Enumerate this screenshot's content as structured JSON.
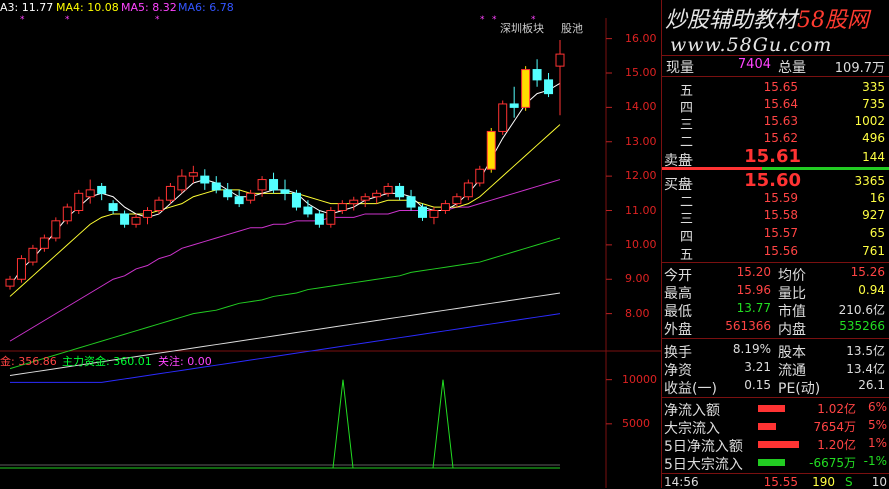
{
  "legend_top": [
    {
      "name": "MA3",
      "label": "A3: 11.77",
      "color": "#ffffff"
    },
    {
      "name": "MA4",
      "label": "MA4: 10.08",
      "color": "#ffff00"
    },
    {
      "name": "MA5",
      "label": "MA5: 8.32",
      "color": "#ff44ff"
    },
    {
      "name": "MA6",
      "label": "MA6: 6.78",
      "color": "#3355ff"
    }
  ],
  "legend_bottom": [
    {
      "name": "fund",
      "label": "金: 356.86",
      "color": "#ff4444"
    },
    {
      "name": "main-fund",
      "label": "主力资金: 360.01",
      "color": "#00ff33"
    },
    {
      "name": "attention",
      "label": "关注: 0.00",
      "color": "#ff44ff"
    }
  ],
  "chart_annotations": {
    "tag1": "深圳板块",
    "tag2": "股池"
  },
  "watermark": {
    "line1_a": "炒股辅助教材",
    "line1_b": "58股网",
    "line2": "www.58Gu.com"
  },
  "price_axis": [
    "16.00",
    "15.00",
    "14.00",
    "13.00",
    "12.00",
    "11.00",
    "10.00",
    "9.00",
    "8.00"
  ],
  "vol_axis": [
    "10000",
    "5000"
  ],
  "quote": {
    "xianliang_label": "现量",
    "xianliang": "7404",
    "zongliang_label": "总量",
    "zongliang": "109.7万",
    "sell": [
      {
        "label": "五",
        "price": "15.65",
        "vol": "335"
      },
      {
        "label": "四",
        "price": "15.64",
        "vol": "735"
      },
      {
        "label": "三",
        "price": "15.63",
        "vol": "1002"
      },
      {
        "label": "二",
        "price": "15.62",
        "vol": "496"
      },
      {
        "label": "一",
        "price": "15.61",
        "vol": "144"
      }
    ],
    "sell_label": "卖盘",
    "buy_label": "买盘",
    "buy": [
      {
        "label": "一",
        "price": "15.60",
        "vol": "3365"
      },
      {
        "label": "二",
        "price": "15.59",
        "vol": "16"
      },
      {
        "label": "三",
        "price": "15.58",
        "vol": "927"
      },
      {
        "label": "四",
        "price": "15.57",
        "vol": "65"
      },
      {
        "label": "五",
        "price": "15.56",
        "vol": "761"
      }
    ],
    "stats": [
      {
        "l1": "今开",
        "v1": "15.20",
        "l2": "均价",
        "v2": "15.26"
      },
      {
        "l1": "最高",
        "v1": "15.96",
        "l2": "量比",
        "v2": "0.94"
      },
      {
        "l1": "最低",
        "v1": "13.77",
        "l2": "市值",
        "v2": "210.6亿"
      },
      {
        "l1": "外盘",
        "v1": "561366",
        "l2": "内盘",
        "v2": "535266"
      }
    ],
    "stats2": [
      {
        "l1": "换手",
        "v1": "8.19%",
        "l2": "股本",
        "v2": "13.5亿"
      },
      {
        "l1": "净资",
        "v1": "3.21",
        "l2": "流通",
        "v2": "13.4亿"
      },
      {
        "l1": "收益(一)",
        "v1": "0.15",
        "l2": "PE(动)",
        "v2": "26.1"
      }
    ],
    "flows": [
      {
        "label": "净流入额",
        "value": "1.02亿",
        "pct": "6%",
        "dir": "up",
        "level": 0.6
      },
      {
        "label": "大宗流入",
        "value": "7654万",
        "pct": "5%",
        "dir": "up",
        "level": 0.4
      },
      {
        "label": "5日净流入额",
        "value": "1.20亿",
        "pct": "1%",
        "dir": "up",
        "level": 0.9
      },
      {
        "label": "5日大宗流入",
        "value": "-6675万",
        "pct": "-1%",
        "dir": "down",
        "level": 0.6
      }
    ],
    "tick": {
      "time": "14:56",
      "price": "15.55",
      "vol": "190",
      "side": "S",
      "count": "10"
    }
  },
  "chart_data": {
    "type": "candlestick",
    "ylim": [
      7.0,
      16.6
    ],
    "candles": [
      [
        8.8,
        9.1,
        8.7,
        9.0
      ],
      [
        9.0,
        9.7,
        8.9,
        9.6
      ],
      [
        9.5,
        10.0,
        9.4,
        9.9
      ],
      [
        9.9,
        10.3,
        9.8,
        10.2
      ],
      [
        10.2,
        10.8,
        10.1,
        10.7
      ],
      [
        10.7,
        11.2,
        10.6,
        11.1
      ],
      [
        11.0,
        11.6,
        10.9,
        11.5
      ],
      [
        11.4,
        11.9,
        11.2,
        11.6
      ],
      [
        11.7,
        11.8,
        11.3,
        11.5
      ],
      [
        11.2,
        11.3,
        10.9,
        11.0
      ],
      [
        10.9,
        11.0,
        10.5,
        10.6
      ],
      [
        10.6,
        10.9,
        10.5,
        10.8
      ],
      [
        10.8,
        11.1,
        10.6,
        11.0
      ],
      [
        11.0,
        11.4,
        10.9,
        11.3
      ],
      [
        11.3,
        11.8,
        11.2,
        11.7
      ],
      [
        11.6,
        12.2,
        11.5,
        12.0
      ],
      [
        12.0,
        12.3,
        11.8,
        12.1
      ],
      [
        12.0,
        12.2,
        11.6,
        11.8
      ],
      [
        11.8,
        12.0,
        11.5,
        11.6
      ],
      [
        11.6,
        11.8,
        11.3,
        11.4
      ],
      [
        11.4,
        11.6,
        11.1,
        11.2
      ],
      [
        11.3,
        11.6,
        11.2,
        11.5
      ],
      [
        11.6,
        12.0,
        11.4,
        11.9
      ],
      [
        11.9,
        12.1,
        11.5,
        11.6
      ],
      [
        11.6,
        11.9,
        11.3,
        11.5
      ],
      [
        11.5,
        11.6,
        11.0,
        11.1
      ],
      [
        11.1,
        11.3,
        10.8,
        10.9
      ],
      [
        10.9,
        11.0,
        10.5,
        10.6
      ],
      [
        10.6,
        11.1,
        10.5,
        11.0
      ],
      [
        11.0,
        11.3,
        10.9,
        11.2
      ],
      [
        11.2,
        11.4,
        11.0,
        11.3
      ],
      [
        11.3,
        11.5,
        11.1,
        11.4
      ],
      [
        11.4,
        11.6,
        11.2,
        11.5
      ],
      [
        11.5,
        11.8,
        11.4,
        11.7
      ],
      [
        11.7,
        11.8,
        11.3,
        11.4
      ],
      [
        11.4,
        11.6,
        11.0,
        11.1
      ],
      [
        11.1,
        11.2,
        10.7,
        10.8
      ],
      [
        10.8,
        11.1,
        10.6,
        11.0
      ],
      [
        11.0,
        11.3,
        10.9,
        11.2
      ],
      [
        11.2,
        11.5,
        11.1,
        11.4
      ],
      [
        11.4,
        11.9,
        11.3,
        11.8
      ],
      [
        11.8,
        12.3,
        11.7,
        12.2
      ],
      [
        12.2,
        13.4,
        12.1,
        13.3
      ],
      [
        13.3,
        14.2,
        13.2,
        14.1
      ],
      [
        14.1,
        14.6,
        13.7,
        14.0
      ],
      [
        14.0,
        15.2,
        13.9,
        15.1
      ],
      [
        15.1,
        15.4,
        14.6,
        14.8
      ],
      [
        14.8,
        15.0,
        14.3,
        14.4
      ],
      [
        15.2,
        15.96,
        13.77,
        15.55
      ]
    ],
    "ma_white": [
      8.8,
      9.3,
      9.6,
      10.0,
      10.4,
      10.8,
      11.1,
      11.4,
      11.5,
      11.4,
      11.1,
      10.9,
      10.8,
      10.9,
      11.2,
      11.5,
      11.8,
      11.9,
      11.8,
      11.6,
      11.4,
      11.4,
      11.5,
      11.6,
      11.6,
      11.5,
      11.2,
      11.0,
      10.9,
      11.0,
      11.1,
      11.3,
      11.4,
      11.5,
      11.5,
      11.4,
      11.1,
      11.0,
      11.0,
      11.2,
      11.5,
      11.9,
      12.5,
      13.1,
      13.6,
      14.1,
      14.4,
      14.5,
      14.7
    ],
    "ma_yellow": [
      8.5,
      8.8,
      9.1,
      9.4,
      9.7,
      10.0,
      10.3,
      10.6,
      10.8,
      10.9,
      10.9,
      10.9,
      10.9,
      11.0,
      11.1,
      11.2,
      11.4,
      11.5,
      11.6,
      11.6,
      11.6,
      11.5,
      11.5,
      11.5,
      11.5,
      11.5,
      11.4,
      11.3,
      11.2,
      11.2,
      11.2,
      11.2,
      11.2,
      11.3,
      11.3,
      11.3,
      11.2,
      11.1,
      11.1,
      11.1,
      11.2,
      11.4,
      11.7,
      12.0,
      12.3,
      12.6,
      12.9,
      13.2,
      13.5
    ],
    "ma_magenta": [
      7.2,
      7.4,
      7.6,
      7.8,
      8.0,
      8.2,
      8.4,
      8.6,
      8.8,
      9.0,
      9.1,
      9.3,
      9.4,
      9.6,
      9.7,
      9.9,
      10.0,
      10.1,
      10.2,
      10.3,
      10.4,
      10.5,
      10.5,
      10.6,
      10.6,
      10.7,
      10.7,
      10.7,
      10.8,
      10.8,
      10.8,
      10.9,
      10.9,
      10.9,
      11.0,
      11.0,
      11.0,
      11.0,
      11.0,
      11.1,
      11.1,
      11.2,
      11.3,
      11.4,
      11.5,
      11.6,
      11.7,
      11.8,
      11.9
    ],
    "ma_green": [
      6.4,
      6.5,
      6.6,
      6.7,
      6.8,
      6.9,
      7.0,
      7.1,
      7.2,
      7.3,
      7.4,
      7.5,
      7.6,
      7.7,
      7.8,
      7.9,
      8.0,
      8.05,
      8.1,
      8.2,
      8.3,
      8.35,
      8.4,
      8.5,
      8.55,
      8.6,
      8.7,
      8.75,
      8.8,
      8.85,
      8.9,
      8.95,
      9.0,
      9.05,
      9.1,
      9.2,
      9.25,
      9.3,
      9.35,
      9.4,
      9.45,
      9.5,
      9.6,
      9.7,
      9.8,
      9.9,
      10.0,
      10.1,
      10.2
    ],
    "ma_gray": [
      6.2,
      6.25,
      6.3,
      6.35,
      6.4,
      6.45,
      6.5,
      6.55,
      6.6,
      6.65,
      6.7,
      6.75,
      6.8,
      6.85,
      6.9,
      6.95,
      7.0,
      7.05,
      7.1,
      7.15,
      7.2,
      7.25,
      7.3,
      7.35,
      7.4,
      7.45,
      7.5,
      7.55,
      7.6,
      7.65,
      7.7,
      7.75,
      7.8,
      7.85,
      7.9,
      7.95,
      8.0,
      8.05,
      8.1,
      8.15,
      8.2,
      8.25,
      8.3,
      8.35,
      8.4,
      8.45,
      8.5,
      8.55,
      8.6
    ],
    "ma_blue": [
      6.0,
      6.0,
      6.0,
      6.0,
      6.0,
      6.0,
      6.0,
      6.0,
      6.0,
      6.05,
      6.1,
      6.15,
      6.2,
      6.25,
      6.3,
      6.35,
      6.4,
      6.45,
      6.5,
      6.55,
      6.6,
      6.65,
      6.7,
      6.75,
      6.8,
      6.85,
      6.9,
      6.95,
      7.0,
      7.05,
      7.1,
      7.15,
      7.2,
      7.25,
      7.3,
      7.35,
      7.4,
      7.45,
      7.5,
      7.55,
      7.6,
      7.65,
      7.7,
      7.75,
      7.8,
      7.85,
      7.9,
      7.95,
      8.0
    ],
    "fund_spikes": [
      {
        "index": 25,
        "value": 10000
      },
      {
        "index": 32,
        "value": 10000
      }
    ],
    "fund_ylim": [
      0,
      12000
    ]
  }
}
